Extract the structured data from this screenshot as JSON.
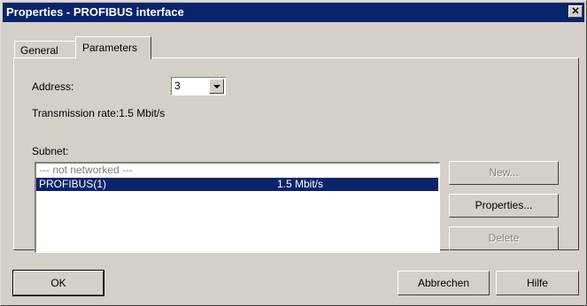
{
  "window": {
    "title": "Properties - PROFIBUS interface",
    "close_glyph": "✕"
  },
  "tabs": [
    {
      "label": "General",
      "active": false
    },
    {
      "label": "Parameters",
      "active": true
    }
  ],
  "parameters": {
    "address_label": "Address:",
    "address_value": "3",
    "transmission_rate": "Transmission rate:1.5 Mbit/s",
    "subnet_label": "Subnet:",
    "subnets": [
      {
        "name": "--- not networked ---",
        "rate": ""
      },
      {
        "name": "PROFIBUS(1)",
        "rate": "1.5 Mbit/s"
      }
    ],
    "selected_index": 1
  },
  "side_buttons": {
    "new": "New...",
    "properties": "Properties...",
    "delete": "Delete"
  },
  "footer": {
    "ok": "OK",
    "cancel": "Abbrechen",
    "help": "Hilfe"
  },
  "colors": {
    "titlebar": "#0a246a",
    "face": "#d4d0c8",
    "selection": "#0a246a"
  },
  "icons": {
    "close": "close-icon",
    "dropdown": "chevron-down-icon"
  }
}
